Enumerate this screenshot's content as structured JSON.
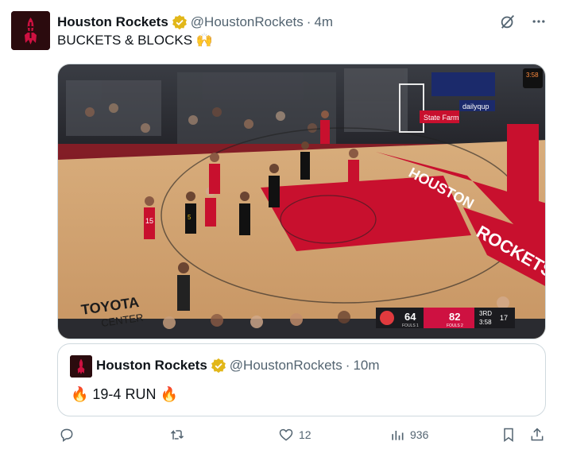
{
  "tweet": {
    "author_name": "Houston Rockets",
    "handle": "@HoustonRockets",
    "separator": "·",
    "time": "4m",
    "text": "BUCKETS & BLOCKS 🙌"
  },
  "media": {
    "scoreboard": {
      "away_score": "64",
      "away_fouls": "FOULS 1",
      "home_score": "82",
      "home_fouls": "FOULS 2",
      "quarter": "3RD",
      "clock": "3:58",
      "shot_clock": "17"
    },
    "corner_badge_time": "3:58",
    "floor_text_left": "TOYOTA",
    "floor_text_left_2": "CENTER",
    "floor_text_baseline": "HOUSTON",
    "floor_text_right": "ROCKETS",
    "sign_statefarm": "State Farm",
    "sign_dailyquip": "dailyqup",
    "player_number": "15",
    "player_number_2": "5"
  },
  "quote": {
    "author_name": "Houston Rockets",
    "handle": "@HoustonRockets",
    "separator": "·",
    "time": "10m",
    "text": "🔥 19-4 RUN 🔥"
  },
  "actions": {
    "reply_count": "",
    "retweet_count": "",
    "like_count": "12",
    "view_count": "936"
  },
  "colors": {
    "rockets_red": "#ce1141",
    "verified_gold": "#e2b719",
    "secondary_text": "#536471",
    "border": "#cfd9de"
  },
  "icons": [
    "rockets-logo-icon",
    "verified-badge-icon",
    "grok-icon",
    "more-icon",
    "reply-icon",
    "retweet-icon",
    "like-icon",
    "views-icon",
    "bookmark-icon",
    "share-icon"
  ]
}
